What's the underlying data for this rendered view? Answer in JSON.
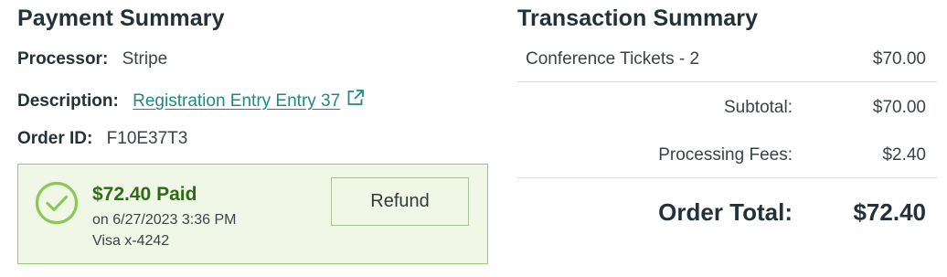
{
  "payment_summary": {
    "title": "Payment Summary",
    "processor_label": "Processor:",
    "processor_value": "Stripe",
    "description_label": "Description:",
    "description_link": "Registration Entry Entry 37",
    "order_id_label": "Order ID:",
    "order_id_value": "F10E37T3",
    "status": {
      "amount_paid": "$72.40 Paid",
      "date": "on 6/27/2023 3:36 PM",
      "card": "Visa x-4242",
      "refund_label": "Refund",
      "icon": "check-circle-icon",
      "accent_color": "#8cc75a",
      "background_color": "#f0f7e6"
    }
  },
  "transaction_summary": {
    "title": "Transaction Summary",
    "items": [
      {
        "description": "Conference Tickets - 2",
        "amount": "$70.00"
      }
    ],
    "subtotal_label": "Subtotal:",
    "subtotal_value": "$70.00",
    "fees_label": "Processing Fees:",
    "fees_value": "$2.40",
    "total_label": "Order Total:",
    "total_value": "$72.40"
  },
  "colors": {
    "link": "#1f8a80",
    "heading": "#233238",
    "paid_text": "#2f6b17"
  }
}
